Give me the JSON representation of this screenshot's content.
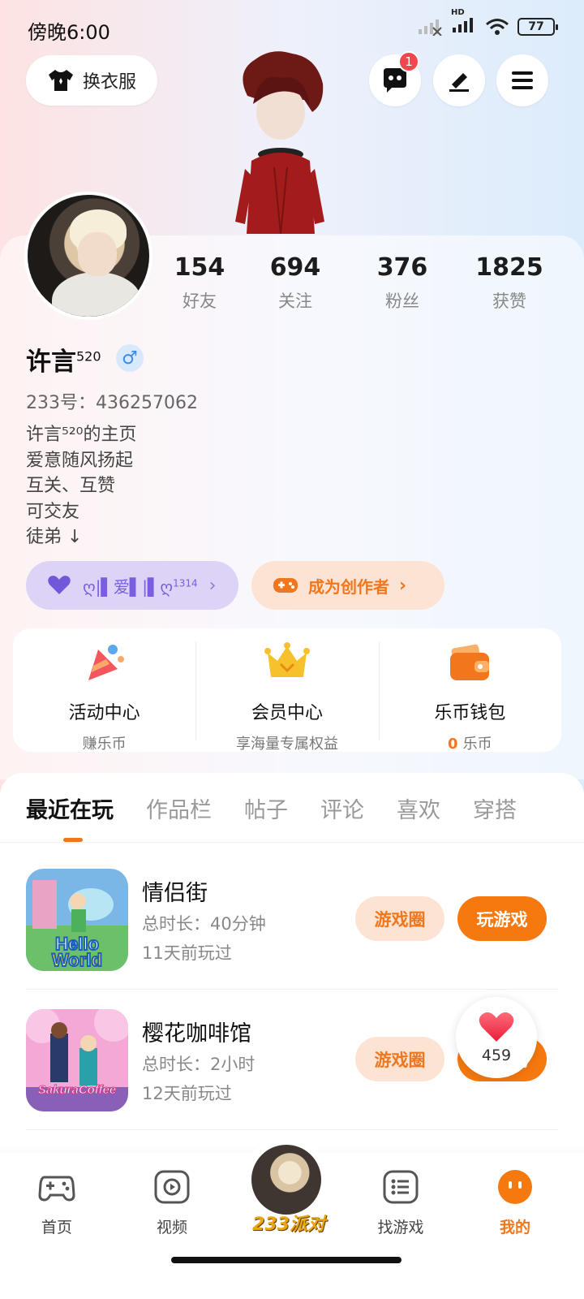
{
  "status_bar": {
    "time": "傍晚6:00",
    "hd": "HD",
    "battery": "77"
  },
  "header": {
    "outfit_label": "换衣服",
    "message_badge": "1"
  },
  "profile": {
    "stats": [
      {
        "num": "154",
        "label": "好友"
      },
      {
        "num": "694",
        "label": "关注"
      },
      {
        "num": "376",
        "label": "粉丝"
      },
      {
        "num": "1825",
        "label": "获赞"
      }
    ],
    "name": "许言",
    "name_sup": "520",
    "gender": "♂",
    "uid": "233号：436257062",
    "bio": [
      "许言⁵²⁰的主页",
      "爱意随风扬起",
      "互关、互赞",
      "可交友",
      "徒弟 ↓"
    ],
    "love_pill": "ღ|▌爱▌|▌ღ",
    "love_sup": "1314",
    "creator_pill": "成为创作者"
  },
  "services": [
    {
      "title": "活动中心",
      "sub": "赚乐币"
    },
    {
      "title": "会员中心",
      "sub": "享海量专属权益"
    },
    {
      "title": "乐币钱包",
      "coin": "0",
      "sub": "乐币"
    }
  ],
  "tabs": [
    "最近在玩",
    "作品栏",
    "帖子",
    "评论",
    "喜欢",
    "穿搭"
  ],
  "games": [
    {
      "title": "情侣街",
      "duration": "总时长：40分钟",
      "last_played": "11天前玩过",
      "thumb_text": "Hello World",
      "circle_btn": "游戏圈",
      "play_btn": "玩游戏"
    },
    {
      "title": "樱花咖啡馆",
      "duration": "总时长：2小时",
      "last_played": "12天前玩过",
      "thumb_text": "SakuraCoffee",
      "circle_btn": "游戏圈",
      "play_btn": "玩游戏"
    }
  ],
  "like_count": "459",
  "bottom_nav": [
    {
      "label": "首页",
      "icon": "gamepad-icon"
    },
    {
      "label": "视频",
      "icon": "video-play-icon"
    },
    {
      "label": "233派对",
      "icon": "avatar"
    },
    {
      "label": "找游戏",
      "icon": "list-icon"
    },
    {
      "label": "我的",
      "icon": "face-icon"
    }
  ],
  "colors": {
    "accent": "#f6790f",
    "badge": "#f0464e",
    "love_pill": "#dcd3f7",
    "creator_pill": "#fde3d3"
  }
}
